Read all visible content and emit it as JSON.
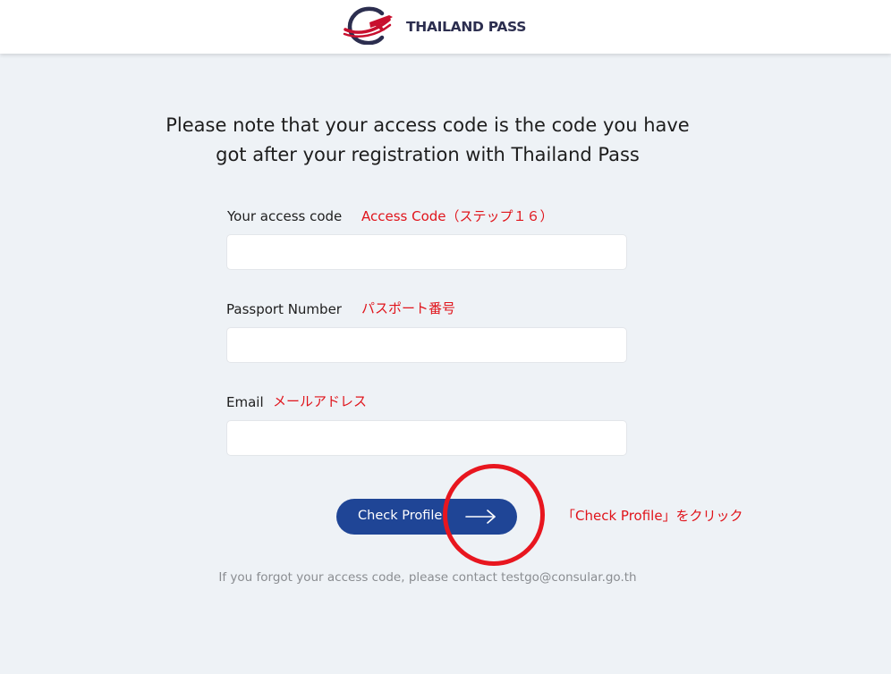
{
  "header": {
    "logo_text": "THAILAND PASS",
    "colors": {
      "logo_navy": "#2c2e4f",
      "logo_red": "#c8102e"
    }
  },
  "notice": {
    "line1": "Please note that your access code is the code you have",
    "line2": "got after your registration with Thailand Pass"
  },
  "form": {
    "access_code": {
      "label": "Your access code",
      "value": "",
      "annotation": "Access Code（ステップ１６）"
    },
    "passport": {
      "label": "Passport Number",
      "value": "",
      "annotation": "パスポート番号"
    },
    "email": {
      "label": "Email",
      "value": "",
      "annotation": "メールアドレス"
    }
  },
  "button": {
    "label": "Check Profile",
    "icon": "arrow-right-icon",
    "annotation": "「Check Profile」をクリック",
    "color": "#1f4596"
  },
  "help_text": "If you forgot your access code, please contact testgo@consular.go.th",
  "annotation_color": "#e0141b"
}
